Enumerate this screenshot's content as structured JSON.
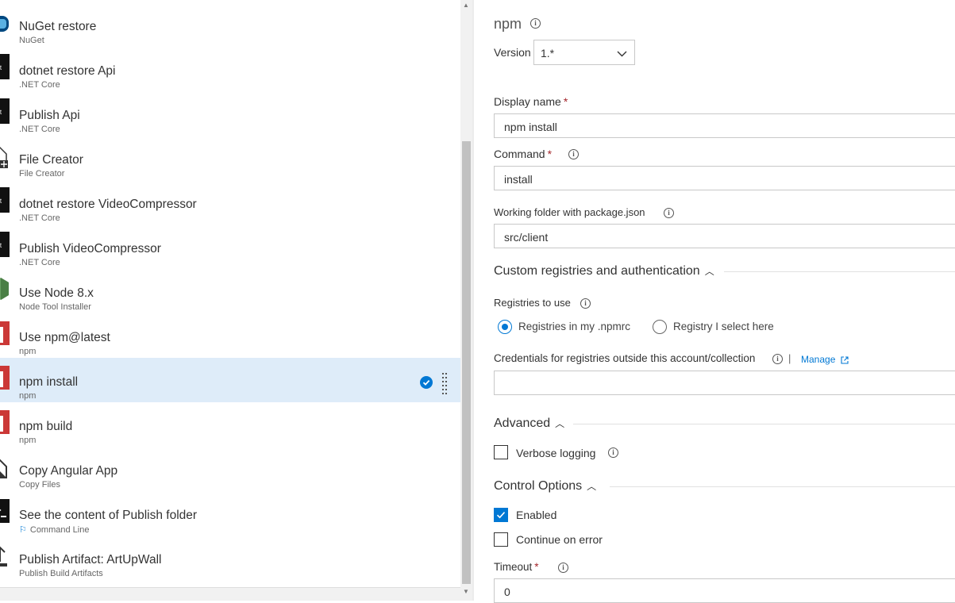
{
  "tasks": [
    {
      "name": "NuGet restore",
      "sub": "NuGet",
      "icon": "nuget-icon"
    },
    {
      "name": "dotnet restore Api",
      "sub": ".NET Core",
      "icon": "dotnet-icon"
    },
    {
      "name": "Publish Api",
      "sub": ".NET Core",
      "icon": "dotnet-icon"
    },
    {
      "name": "File Creator",
      "sub": "File Creator",
      "icon": "file-creator-icon"
    },
    {
      "name": "dotnet restore VideoCompressor",
      "sub": ".NET Core",
      "icon": "dotnet-icon"
    },
    {
      "name": "Publish VideoCompressor",
      "sub": ".NET Core",
      "icon": "dotnet-icon"
    },
    {
      "name": "Use Node 8.x",
      "sub": "Node Tool Installer",
      "icon": "node-icon"
    },
    {
      "name": "Use npm@latest",
      "sub": "npm",
      "icon": "npm-icon"
    },
    {
      "name": "npm install",
      "sub": "npm",
      "icon": "npm-icon",
      "selected": true
    },
    {
      "name": "npm build",
      "sub": "npm",
      "icon": "npm-icon"
    },
    {
      "name": "Copy Angular App",
      "sub": "Copy Files",
      "icon": "copy-files-icon"
    },
    {
      "name": "See the content of Publish folder",
      "sub": "Command Line",
      "icon": "command-line-icon",
      "flag": true
    },
    {
      "name": "Publish Artifact: ArtUpWall",
      "sub": "Publish Build Artifacts",
      "icon": "publish-artifact-icon"
    }
  ],
  "panel": {
    "title": "npm",
    "version_label": "Version",
    "version_value": "1.*",
    "display_name_label": "Display name",
    "display_name_value": "npm install",
    "command_label": "Command",
    "command_value": "install",
    "working_folder_label": "Working folder with package.json",
    "working_folder_value": "src/client",
    "custom_registries_title": "Custom registries and authentication",
    "registries_label": "Registries to use",
    "radio_npmrc": "Registries in my .npmrc",
    "radio_select": "Registry I select here",
    "credentials_label": "Credentials for registries outside this account/collection",
    "separator": "|",
    "manage_link": "Manage",
    "advanced_title": "Advanced",
    "verbose_label": "Verbose logging",
    "control_options_title": "Control Options",
    "enabled_label": "Enabled",
    "continue_on_error_label": "Continue on error",
    "timeout_label": "Timeout",
    "timeout_value": "0",
    "required_mark": "*"
  },
  "colors": {
    "accent": "#0078d4",
    "npm_red": "#cb3837",
    "node_green": "#68a063",
    "selected_bg": "#deecf9"
  }
}
